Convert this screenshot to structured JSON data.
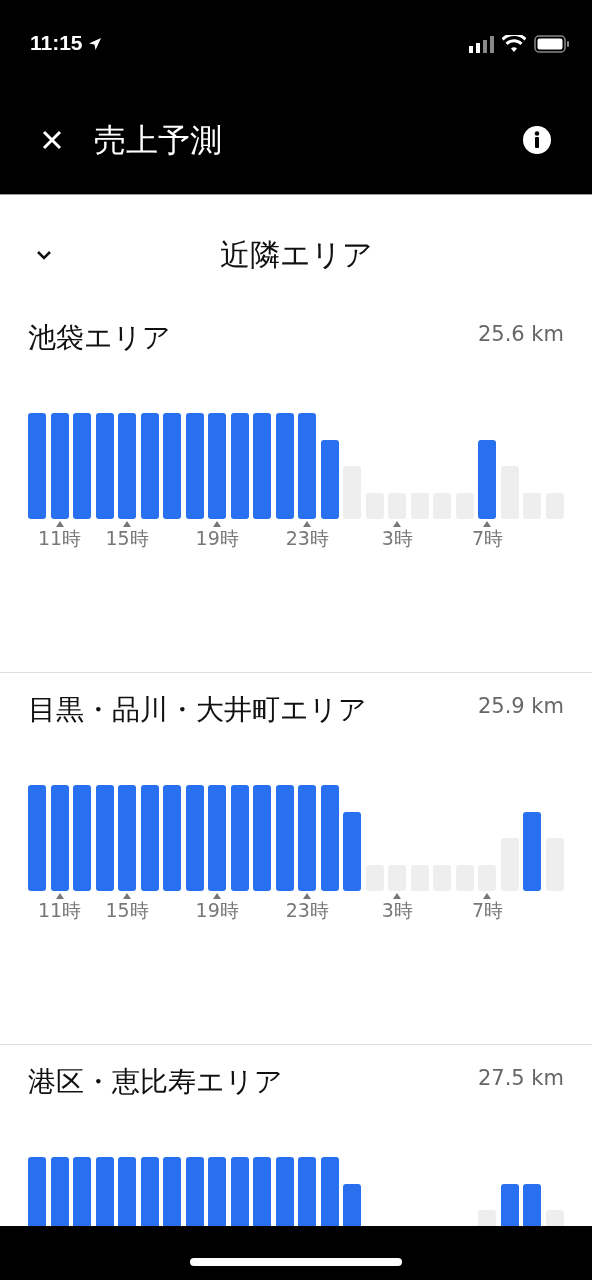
{
  "status_bar": {
    "time": "11:15"
  },
  "header": {
    "title": "売上予測"
  },
  "section": {
    "title": "近隣エリア",
    "expanded": true
  },
  "areas": [
    {
      "name": "池袋エリア",
      "distance": "25.6 km",
      "bars": [
        {
          "kind": "full",
          "active": true
        },
        {
          "kind": "full",
          "active": true,
          "tick": "11時"
        },
        {
          "kind": "full",
          "active": true
        },
        {
          "kind": "full",
          "active": true
        },
        {
          "kind": "full",
          "active": true,
          "tick": "15時"
        },
        {
          "kind": "full",
          "active": true
        },
        {
          "kind": "full",
          "active": true
        },
        {
          "kind": "full",
          "active": true
        },
        {
          "kind": "full",
          "active": true,
          "tick": "19時"
        },
        {
          "kind": "full",
          "active": true
        },
        {
          "kind": "full",
          "active": true
        },
        {
          "kind": "full",
          "active": true
        },
        {
          "kind": "full",
          "active": true,
          "tick": "23時"
        },
        {
          "kind": "high",
          "active": true
        },
        {
          "kind": "mid",
          "active": false
        },
        {
          "kind": "low",
          "active": false
        },
        {
          "kind": "low",
          "active": false,
          "tick": "3時"
        },
        {
          "kind": "low",
          "active": false
        },
        {
          "kind": "low",
          "active": false
        },
        {
          "kind": "low",
          "active": false
        },
        {
          "kind": "high",
          "active": true,
          "tick": "7時"
        },
        {
          "kind": "mid",
          "active": false
        },
        {
          "kind": "low",
          "active": false
        },
        {
          "kind": "low",
          "active": false
        }
      ]
    },
    {
      "name": "目黒・品川・大井町エリア",
      "distance": "25.9 km",
      "bars": [
        {
          "kind": "full",
          "active": true
        },
        {
          "kind": "full",
          "active": true,
          "tick": "11時"
        },
        {
          "kind": "full",
          "active": true
        },
        {
          "kind": "full",
          "active": true
        },
        {
          "kind": "full",
          "active": true,
          "tick": "15時"
        },
        {
          "kind": "full",
          "active": true
        },
        {
          "kind": "full",
          "active": true
        },
        {
          "kind": "full",
          "active": true
        },
        {
          "kind": "full",
          "active": true,
          "tick": "19時"
        },
        {
          "kind": "full",
          "active": true
        },
        {
          "kind": "full",
          "active": true
        },
        {
          "kind": "full",
          "active": true
        },
        {
          "kind": "full",
          "active": true,
          "tick": "23時"
        },
        {
          "kind": "full",
          "active": true
        },
        {
          "kind": "high",
          "active": true
        },
        {
          "kind": "low",
          "active": false
        },
        {
          "kind": "low",
          "active": false,
          "tick": "3時"
        },
        {
          "kind": "low",
          "active": false
        },
        {
          "kind": "low",
          "active": false
        },
        {
          "kind": "low",
          "active": false
        },
        {
          "kind": "low",
          "active": false,
          "tick": "7時"
        },
        {
          "kind": "mid",
          "active": false
        },
        {
          "kind": "high",
          "active": true
        },
        {
          "kind": "mid",
          "active": false
        }
      ]
    },
    {
      "name": "港区・恵比寿エリア",
      "distance": "27.5 km",
      "bars": [
        {
          "kind": "full",
          "active": true
        },
        {
          "kind": "full",
          "active": true
        },
        {
          "kind": "full",
          "active": true
        },
        {
          "kind": "full",
          "active": true
        },
        {
          "kind": "full",
          "active": true
        },
        {
          "kind": "full",
          "active": true
        },
        {
          "kind": "full",
          "active": true
        },
        {
          "kind": "full",
          "active": true
        },
        {
          "kind": "full",
          "active": true
        },
        {
          "kind": "full",
          "active": true
        },
        {
          "kind": "full",
          "active": true
        },
        {
          "kind": "full",
          "active": true
        },
        {
          "kind": "full",
          "active": true
        },
        {
          "kind": "full",
          "active": true
        },
        {
          "kind": "high",
          "active": true
        },
        {
          "kind": "none"
        },
        {
          "kind": "none"
        },
        {
          "kind": "none"
        },
        {
          "kind": "none"
        },
        {
          "kind": "none"
        },
        {
          "kind": "mid",
          "active": false
        },
        {
          "kind": "high",
          "active": true
        },
        {
          "kind": "high",
          "active": true
        },
        {
          "kind": "mid",
          "active": false
        }
      ]
    }
  ]
}
